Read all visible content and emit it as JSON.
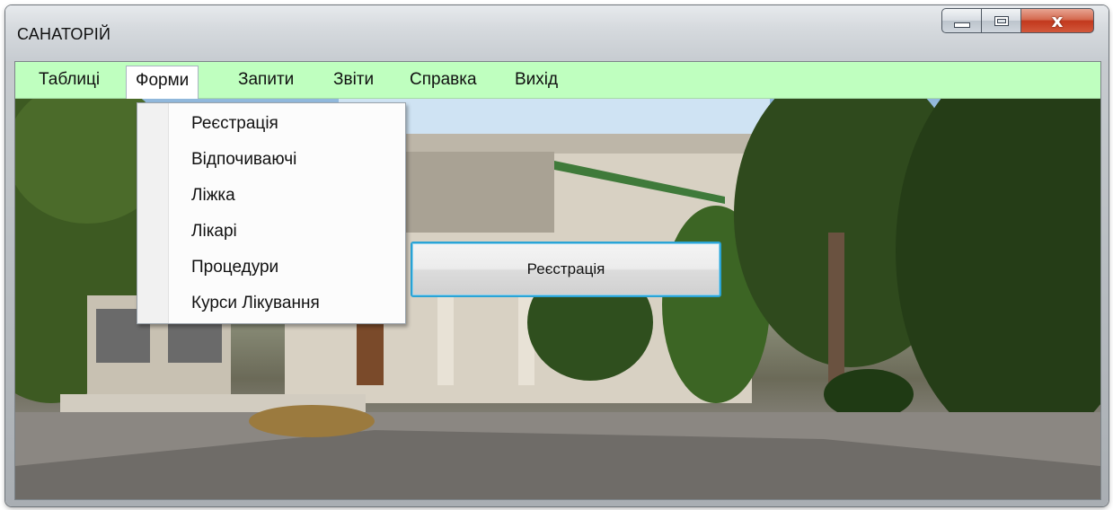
{
  "window": {
    "title": "САНАТОРІЙ",
    "controls": {
      "minimize_icon": "minimize-icon",
      "maximize_icon": "maximize-icon",
      "close_icon": "close-icon",
      "close_glyph": "x"
    }
  },
  "menubar": {
    "items": [
      {
        "label": "Таблиці"
      },
      {
        "label": "Форми",
        "active": true
      },
      {
        "label": "Запити"
      },
      {
        "label": "Звіти"
      },
      {
        "label": "Справка"
      },
      {
        "label": "Вихід"
      }
    ],
    "background_color": "#bfffbf"
  },
  "dropdown": {
    "items": [
      {
        "label": "Реєстрація"
      },
      {
        "label": "Відпочиваючі"
      },
      {
        "label": "Ліжка"
      },
      {
        "label": "Лікарі"
      },
      {
        "label": "Процедури"
      },
      {
        "label": "Курси Лікування"
      }
    ]
  },
  "main": {
    "register_button_label": "Реєстрація",
    "focus_color": "#2aa4d6",
    "background_image": "sanatorium-building-photo"
  }
}
